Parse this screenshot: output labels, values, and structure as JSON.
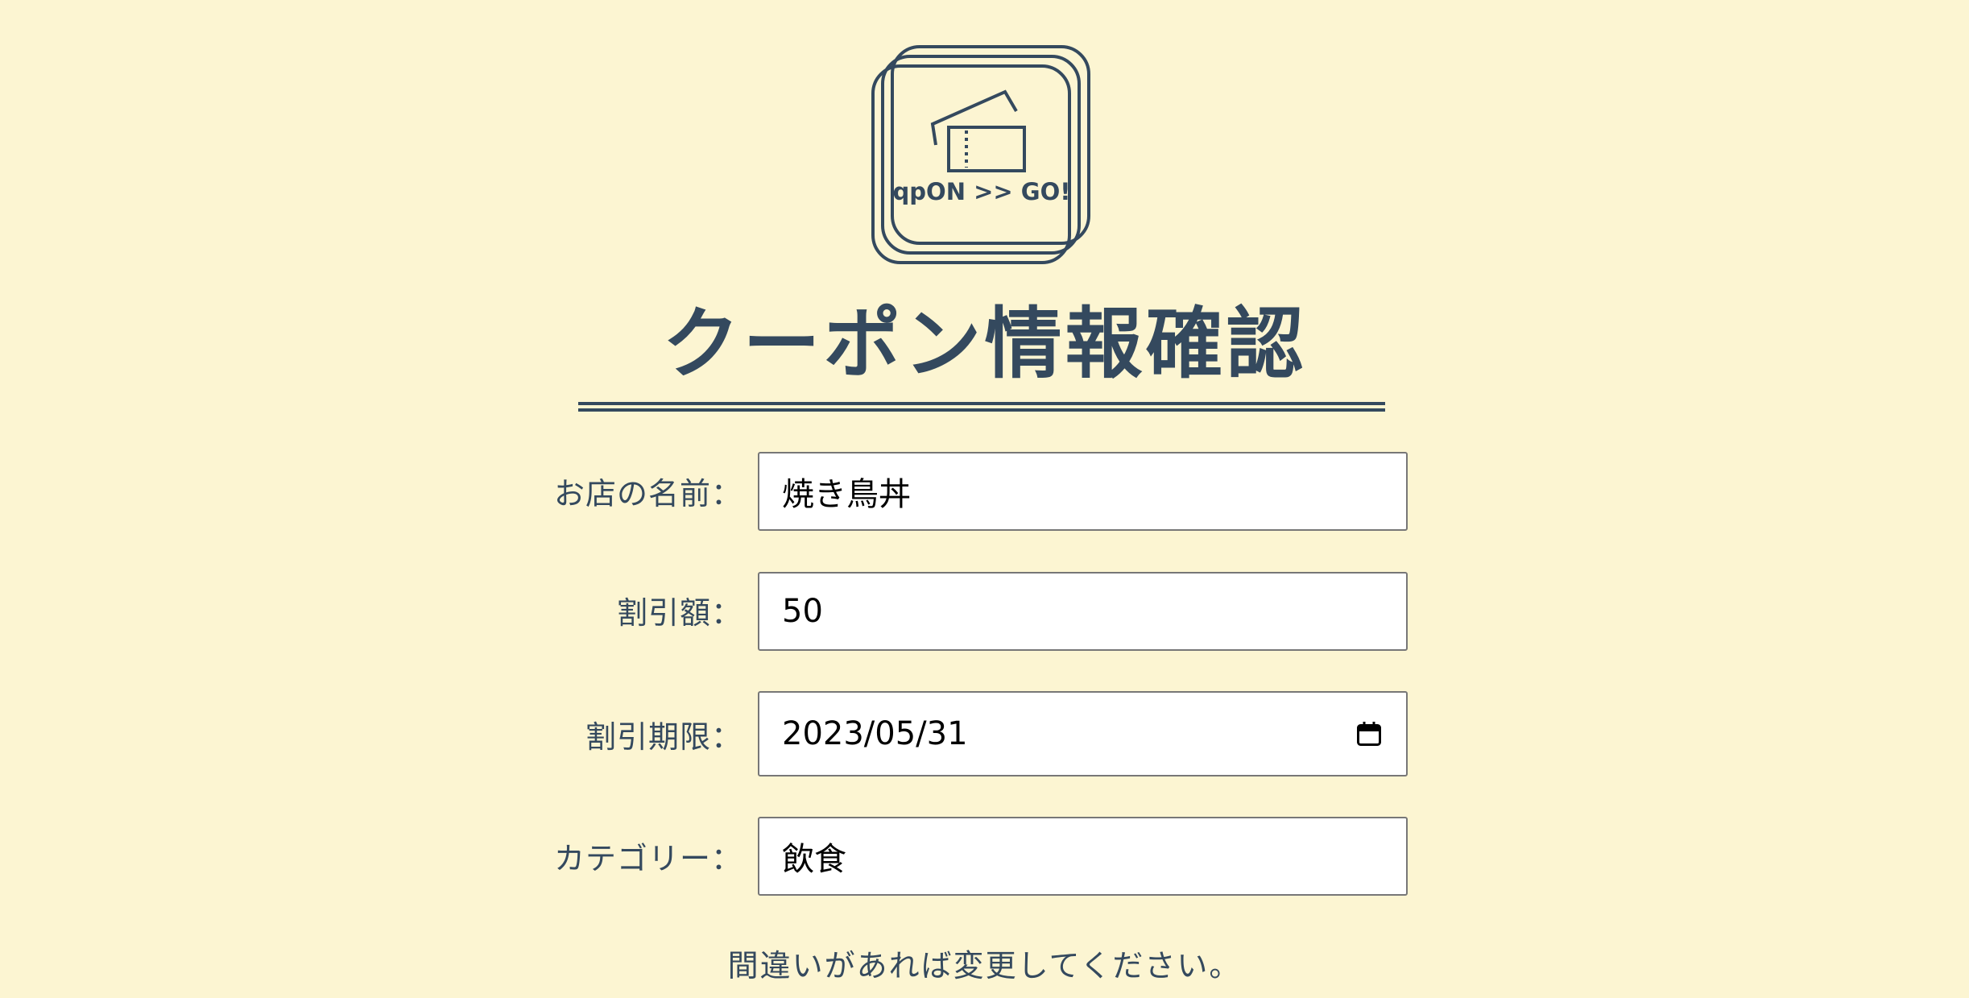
{
  "logo": {
    "icon": "qpon-ticket-logo-icon",
    "text": "qpON >> GO!"
  },
  "page": {
    "title": "クーポン情報確認",
    "note": "間違いがあれば変更してください。"
  },
  "form": {
    "shop_name": {
      "label": "お店の名前：",
      "value": "焼き鳥丼"
    },
    "discount": {
      "label": "割引額：",
      "value": "50"
    },
    "expiry": {
      "label": "割引期限：",
      "value": "2023/05/31",
      "icon": "calendar-icon"
    },
    "category": {
      "label": "カテゴリー：",
      "value": "飲食"
    }
  },
  "colors": {
    "background": "#fcf5d2",
    "primary_text": "#34495e",
    "field_background": "#ffffff",
    "field_border": "#777777"
  }
}
